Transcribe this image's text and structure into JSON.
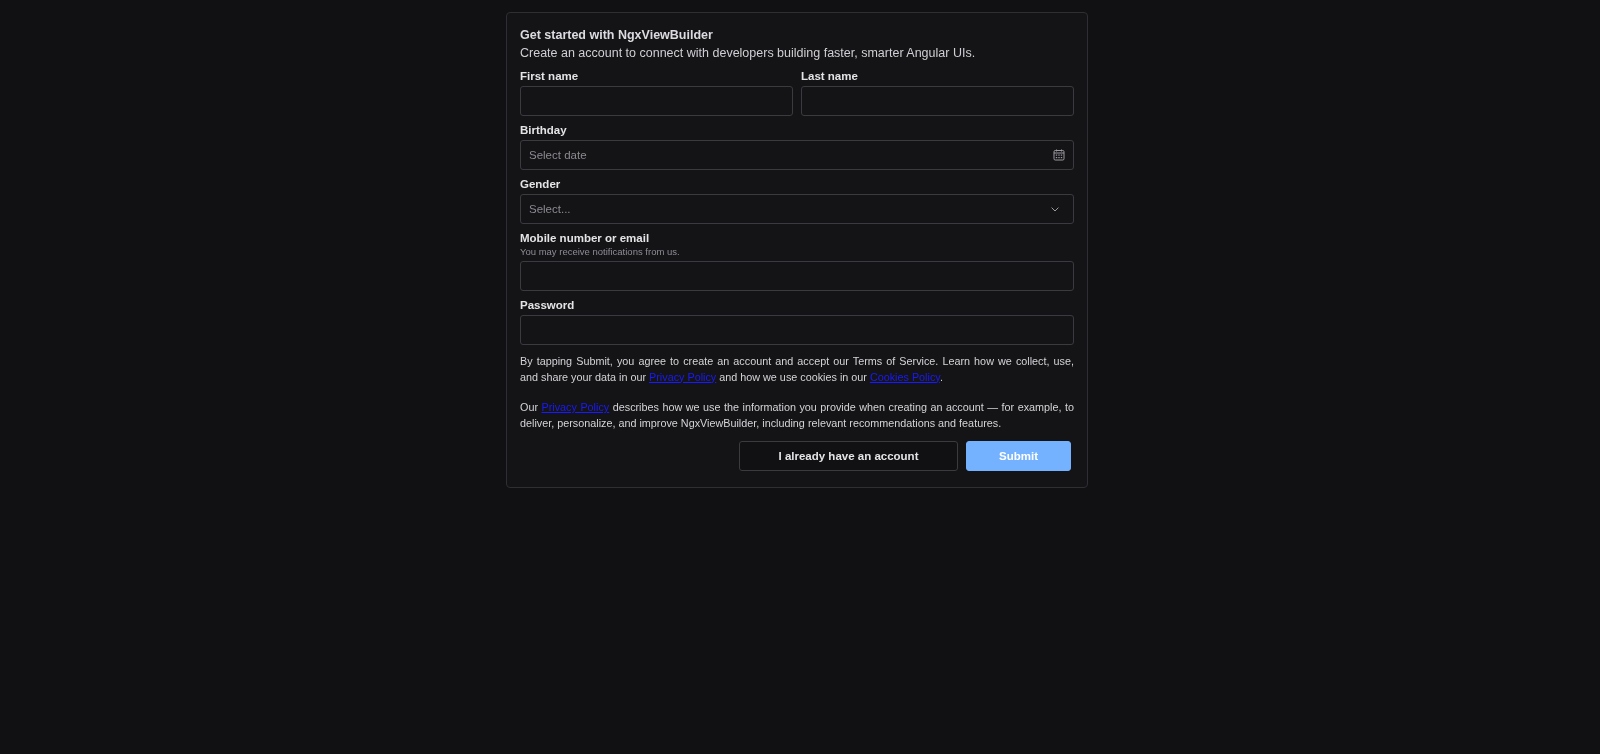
{
  "form": {
    "title": "Get started with NgxViewBuilder",
    "subtitle": "Create an account to connect with developers building faster, smarter Angular UIs.",
    "name_fields": [
      {
        "label": "First name"
      },
      {
        "label": "Last name"
      }
    ],
    "fields": [
      {
        "kind": "date",
        "label": "Birthday",
        "placeholder": "Select date"
      },
      {
        "kind": "select",
        "label": "Gender",
        "placeholder": "Select..."
      },
      {
        "kind": "text",
        "label": "Mobile number or email",
        "hint": "You may receive notifications from us."
      },
      {
        "kind": "password",
        "label": "Password"
      }
    ],
    "legal": [
      {
        "parts": [
          {
            "kind": "text",
            "text": "By tapping Submit, you agree to create an account and accept our Terms of Service. Learn how we collect, use, and share your data in our "
          },
          {
            "kind": "link",
            "text": "Privacy Policy"
          },
          {
            "kind": "text",
            "text": " and how we use cookies in our "
          },
          {
            "kind": "link",
            "text": "Cookies Policy"
          },
          {
            "kind": "text",
            "text": "."
          }
        ]
      },
      {
        "parts": [
          {
            "kind": "text",
            "text": "Our "
          },
          {
            "kind": "link",
            "text": "Privacy Policy"
          },
          {
            "kind": "text",
            "text": " describes how we use the information you provide when creating an account — for example, to deliver, personalize, and improve NgxViewBuilder, including relevant recommendations and features."
          }
        ]
      }
    ],
    "buttons": [
      {
        "kind": "secondary",
        "label": "I already have an account"
      },
      {
        "kind": "primary",
        "label": "Submit"
      }
    ]
  }
}
